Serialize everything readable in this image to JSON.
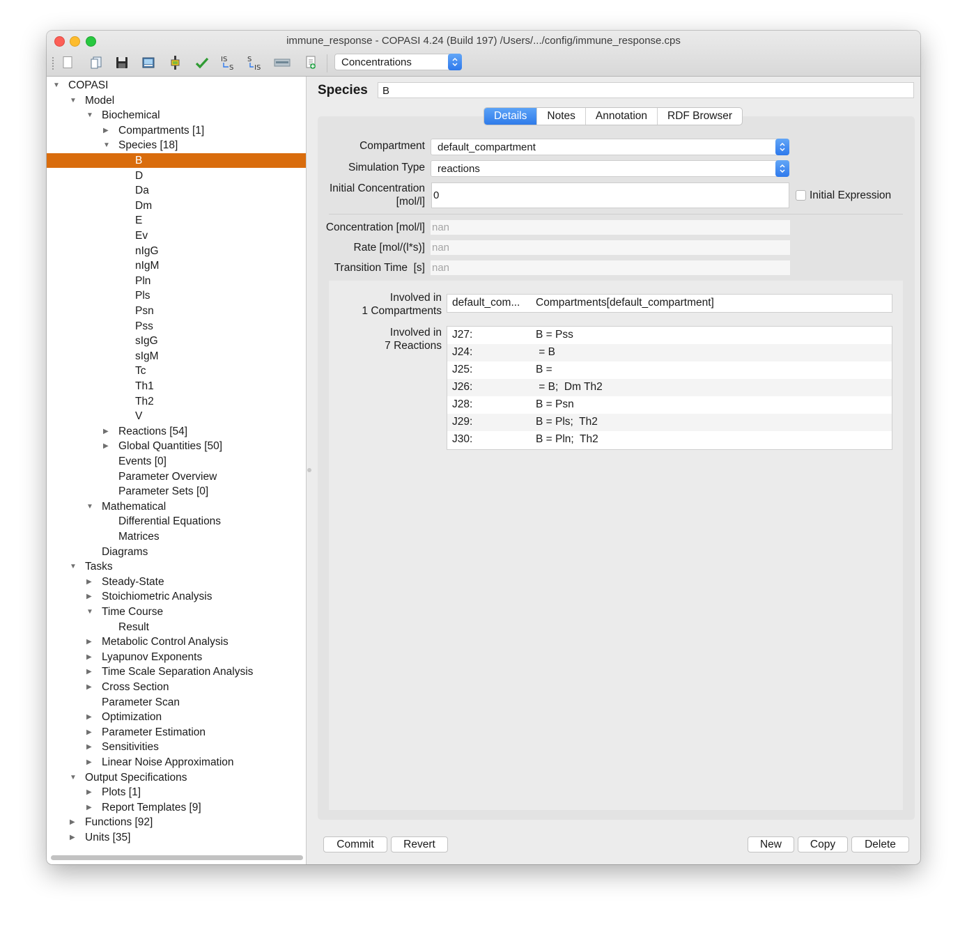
{
  "window": {
    "title": "immune_response - COPASI 4.24 (Build 197) /Users/.../config/immune_response.cps"
  },
  "toolbar": {
    "buttons": [
      "new-file-icon",
      "open-file-icon",
      "save-icon",
      "save-as-image-icon",
      "slider-icon",
      "check-model-icon",
      "is-to-s-icon",
      "s-to-is-icon",
      "function-db-icon",
      "add-list-icon"
    ],
    "is_s_label_top": "IS",
    "is_s_label_bottom": "S",
    "s_is_label_top": "S",
    "s_is_label_bottom": "IS",
    "value_type": "Concentrations"
  },
  "tree": [
    {
      "label": "COPASI",
      "level": 0,
      "arrow": "down"
    },
    {
      "label": "Model",
      "level": 1,
      "arrow": "down"
    },
    {
      "label": "Biochemical",
      "level": 2,
      "arrow": "down"
    },
    {
      "label": "Compartments [1]",
      "level": 3,
      "arrow": "right"
    },
    {
      "label": "Species [18]",
      "level": 3,
      "arrow": "down"
    },
    {
      "label": "B",
      "level": 4,
      "selected": true
    },
    {
      "label": "D",
      "level": 4
    },
    {
      "label": "Da",
      "level": 4
    },
    {
      "label": "Dm",
      "level": 4
    },
    {
      "label": "E",
      "level": 4
    },
    {
      "label": "Ev",
      "level": 4
    },
    {
      "label": "nIgG",
      "level": 4
    },
    {
      "label": "nIgM",
      "level": 4
    },
    {
      "label": "Pln",
      "level": 4
    },
    {
      "label": "Pls",
      "level": 4
    },
    {
      "label": "Psn",
      "level": 4
    },
    {
      "label": "Pss",
      "level": 4
    },
    {
      "label": "sIgG",
      "level": 4
    },
    {
      "label": "sIgM",
      "level": 4
    },
    {
      "label": "Tc",
      "level": 4
    },
    {
      "label": "Th1",
      "level": 4
    },
    {
      "label": "Th2",
      "level": 4
    },
    {
      "label": "V",
      "level": 4
    },
    {
      "label": "Reactions [54]",
      "level": 3,
      "arrow": "right"
    },
    {
      "label": "Global Quantities [50]",
      "level": 3,
      "arrow": "right"
    },
    {
      "label": "Events [0]",
      "level": 3
    },
    {
      "label": "Parameter Overview",
      "level": 3
    },
    {
      "label": "Parameter Sets [0]",
      "level": 3
    },
    {
      "label": "Mathematical",
      "level": 2,
      "arrow": "down"
    },
    {
      "label": "Differential Equations",
      "level": 3
    },
    {
      "label": "Matrices",
      "level": 3
    },
    {
      "label": "Diagrams",
      "level": 2
    },
    {
      "label": "Tasks",
      "level": 1,
      "arrow": "down"
    },
    {
      "label": "Steady-State",
      "level": 2,
      "arrow": "right"
    },
    {
      "label": "Stoichiometric Analysis",
      "level": 2,
      "arrow": "right"
    },
    {
      "label": "Time Course",
      "level": 2,
      "arrow": "down"
    },
    {
      "label": "Result",
      "level": 3
    },
    {
      "label": "Metabolic Control Analysis",
      "level": 2,
      "arrow": "right"
    },
    {
      "label": "Lyapunov Exponents",
      "level": 2,
      "arrow": "right"
    },
    {
      "label": "Time Scale Separation Analysis",
      "level": 2,
      "arrow": "right"
    },
    {
      "label": "Cross Section",
      "level": 2,
      "arrow": "right"
    },
    {
      "label": "Parameter Scan",
      "level": 2
    },
    {
      "label": "Optimization",
      "level": 2,
      "arrow": "right"
    },
    {
      "label": "Parameter Estimation",
      "level": 2,
      "arrow": "right"
    },
    {
      "label": "Sensitivities",
      "level": 2,
      "arrow": "right"
    },
    {
      "label": "Linear Noise Approximation",
      "level": 2,
      "arrow": "right"
    },
    {
      "label": "Output Specifications",
      "level": 1,
      "arrow": "down"
    },
    {
      "label": "Plots [1]",
      "level": 2,
      "arrow": "right"
    },
    {
      "label": "Report Templates [9]",
      "level": 2,
      "arrow": "right"
    },
    {
      "label": "Functions [92]",
      "level": 1,
      "arrow": "right"
    },
    {
      "label": "Units [35]",
      "level": 1,
      "arrow": "right"
    }
  ],
  "species": {
    "heading": "Species",
    "name": "B",
    "tabs": [
      {
        "label": "Details",
        "active": true
      },
      {
        "label": "Notes"
      },
      {
        "label": "Annotation"
      },
      {
        "label": "RDF Browser"
      }
    ],
    "compartment_label": "Compartment",
    "compartment_value": "default_compartment",
    "simulation_type_label": "Simulation Type",
    "simulation_type_value": "reactions",
    "initial_conc_label_1": "Initial Concentration",
    "initial_conc_label_2": "[mol/l]",
    "initial_conc_value": "0",
    "initial_expression_label": "Initial Expression",
    "initial_expression_checked": false,
    "concentration_label": "Concentration [mol/l]",
    "concentration_value": "nan",
    "rate_label": "Rate [mol/(l*s)]",
    "rate_value": "nan",
    "transition_label": "Transition Time  [s]",
    "transition_value": "nan",
    "involved_comp_label_1": "Involved in",
    "involved_comp_label_2": "1 Compartments",
    "compartments": [
      {
        "short": "default_com...",
        "full": "Compartments[default_compartment]"
      }
    ],
    "involved_reac_label_1": "Involved in",
    "involved_reac_label_2": "7 Reactions",
    "reactions": [
      {
        "id": "J27:",
        "eq": "B = Pss"
      },
      {
        "id": "J24:",
        "eq": " = B"
      },
      {
        "id": "J25:",
        "eq": "B = "
      },
      {
        "id": "J26:",
        "eq": " = B;  Dm Th2"
      },
      {
        "id": "J28:",
        "eq": "B = Psn"
      },
      {
        "id": "J29:",
        "eq": "B = Pls;  Th2"
      },
      {
        "id": "J30:",
        "eq": "B = Pln;  Th2"
      }
    ]
  },
  "buttons": {
    "commit": "Commit",
    "revert": "Revert",
    "new": "New",
    "copy": "Copy",
    "delete": "Delete"
  },
  "colors": {
    "selection": "#d96c0c",
    "accent": "#2f7be9"
  }
}
